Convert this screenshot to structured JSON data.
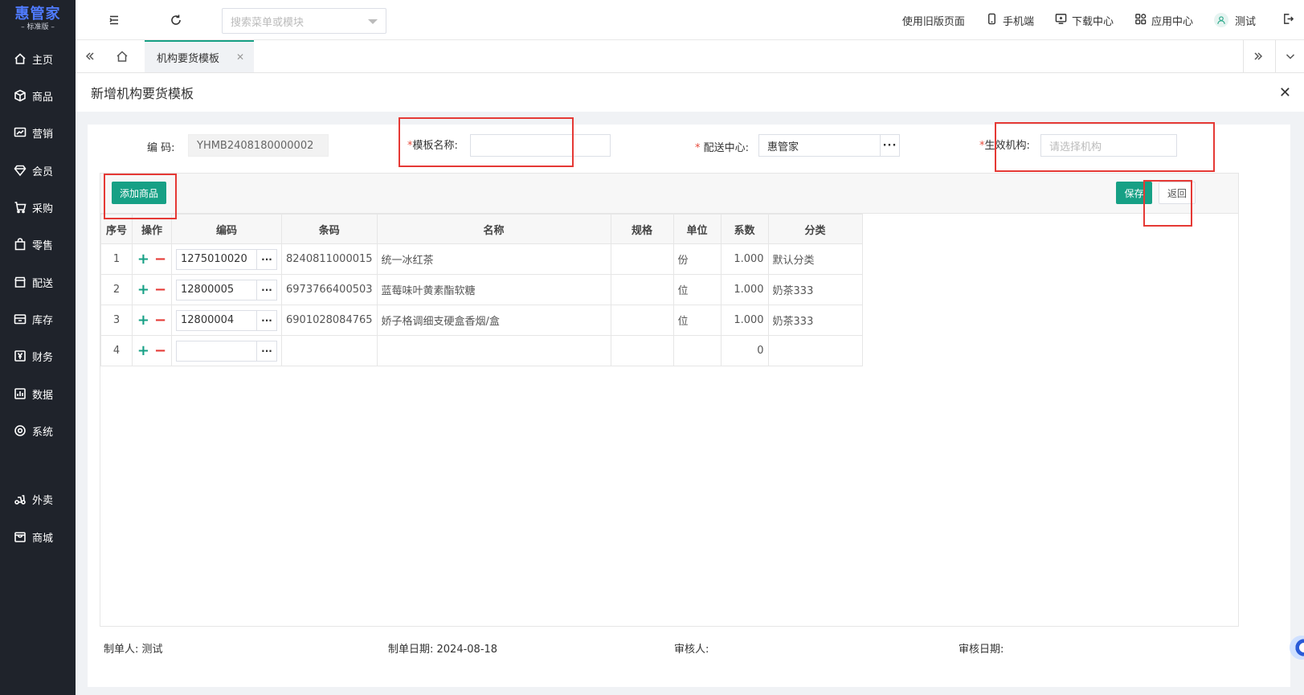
{
  "app": {
    "logo_main": "惠管家",
    "logo_sub": "– 标准版 –"
  },
  "sidebar": {
    "items": [
      {
        "label": "主页",
        "icon": "home-icon"
      },
      {
        "label": "商品",
        "icon": "cube-icon"
      },
      {
        "label": "营销",
        "icon": "chart-line-icon"
      },
      {
        "label": "会员",
        "icon": "diamond-icon"
      },
      {
        "label": "采购",
        "icon": "cart-icon"
      },
      {
        "label": "零售",
        "icon": "bag-icon"
      },
      {
        "label": "配送",
        "icon": "store-icon"
      },
      {
        "label": "库存",
        "icon": "box-icon"
      },
      {
        "label": "财务",
        "icon": "yen-icon"
      },
      {
        "label": "数据",
        "icon": "bar-chart-icon"
      },
      {
        "label": "系统",
        "icon": "settings-icon"
      },
      {
        "label": "外卖",
        "icon": "delivery-icon"
      },
      {
        "label": "商城",
        "icon": "mall-icon"
      }
    ]
  },
  "topbar": {
    "search_placeholder": "搜索菜单或模块",
    "links": {
      "old_version": "使用旧版页面",
      "mobile": "手机端",
      "download": "下载中心",
      "apps": "应用中心",
      "user": "测试"
    }
  },
  "tabs": {
    "active": "机构要货模板"
  },
  "modal": {
    "title": "新增机构要货模板",
    "form": {
      "code_label": "编 码:",
      "code_value": "YHMB2408180000002",
      "name_req": "*",
      "name_label": "模板名称:",
      "name_value": "",
      "center_req": "*",
      "center_label": " 配送中心:",
      "center_value": "惠管家",
      "org_req": "*",
      "org_label": "生效机构:",
      "org_placeholder": "请选择机构"
    },
    "buttons": {
      "add": "添加商品",
      "save": "保存",
      "back": "返回"
    },
    "table": {
      "headers": [
        "序号",
        "操作",
        "编码",
        "条码",
        "名称",
        "规格",
        "单位",
        "系数",
        "分类"
      ],
      "rows": [
        {
          "no": "1",
          "code": "1275010020",
          "barcode": "8240811000015",
          "name": "统一冰红茶",
          "spec": "",
          "unit": "份",
          "ratio": "1.000",
          "category": "默认分类"
        },
        {
          "no": "2",
          "code": "12800005",
          "barcode": "6973766400503",
          "name": "蓝莓味叶黄素酯软糖",
          "spec": "",
          "unit": "位",
          "ratio": "1.000",
          "category": "奶茶333"
        },
        {
          "no": "3",
          "code": "12800004",
          "barcode": "6901028084765",
          "name": "娇子格调细支硬盒香烟/盒",
          "spec": "",
          "unit": "位",
          "ratio": "1.000",
          "category": "奶茶333"
        },
        {
          "no": "4",
          "code": "",
          "barcode": "",
          "name": "",
          "spec": "",
          "unit": "",
          "ratio": "0",
          "category": ""
        }
      ]
    },
    "footer": {
      "creator": "制单人: 测试",
      "create_date": "制单日期: 2024-08-18",
      "auditor": "审核人:",
      "audit_date": "审核日期:"
    }
  },
  "colors": {
    "accent": "#16a085",
    "sidebar_bg": "#1f232b",
    "highlight_box": "#e53935"
  }
}
